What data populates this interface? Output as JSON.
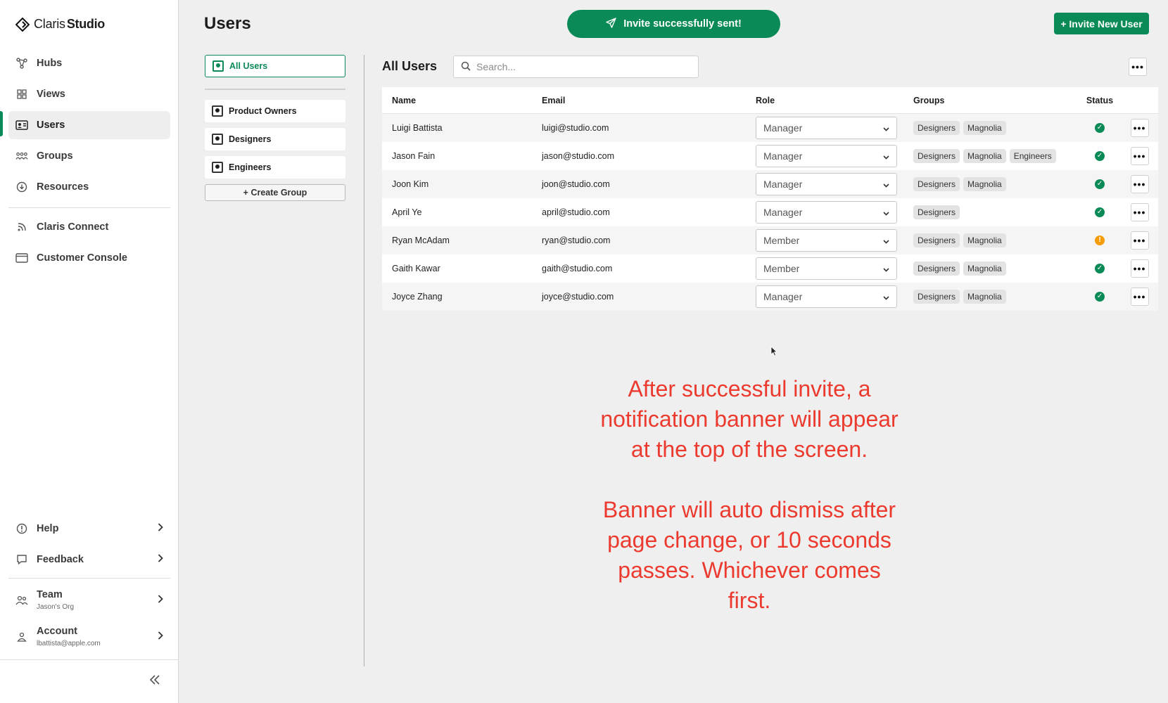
{
  "app": {
    "brand_light": "Claris",
    "brand_bold": "Studio"
  },
  "sidebar": {
    "items": [
      {
        "label": "Hubs",
        "icon": "hubs-icon"
      },
      {
        "label": "Views",
        "icon": "grid-icon"
      },
      {
        "label": "Users",
        "icon": "id-card-icon",
        "active": true
      },
      {
        "label": "Groups",
        "icon": "people-icon"
      },
      {
        "label": "Resources",
        "icon": "download-circle-icon"
      }
    ],
    "secondary": [
      {
        "label": "Claris Connect",
        "icon": "feed-icon"
      },
      {
        "label": "Customer Console",
        "icon": "window-icon"
      }
    ],
    "bottom": [
      {
        "label": "Help",
        "icon": "info-icon"
      },
      {
        "label": "Feedback",
        "icon": "chat-icon"
      }
    ],
    "team": {
      "label": "Team",
      "sub": "Jason's Org"
    },
    "account": {
      "label": "Account",
      "sub": "lbattista@apple.com"
    }
  },
  "header": {
    "title": "Users",
    "toast": "Invite successfully sent!",
    "invite_button": "+ Invite New User"
  },
  "groups": {
    "all": "All Users",
    "list": [
      "Product Owners",
      "Designers",
      "Engineers"
    ],
    "create": "+ Create Group"
  },
  "table": {
    "title": "All Users",
    "search_placeholder": "Search...",
    "columns": [
      "Name",
      "Email",
      "Role",
      "Groups",
      "Status"
    ],
    "rows": [
      {
        "name": "Luigi Battista",
        "email": "luigi@studio.com",
        "role": "Manager",
        "groups": [
          "Designers",
          "Magnolia"
        ],
        "status": "ok"
      },
      {
        "name": "Jason Fain",
        "email": "jason@studio.com",
        "role": "Manager",
        "groups": [
          "Designers",
          "Magnolia",
          "Engineers"
        ],
        "status": "ok"
      },
      {
        "name": "Joon Kim",
        "email": "joon@studio.com",
        "role": "Manager",
        "groups": [
          "Designers",
          "Magnolia"
        ],
        "status": "ok"
      },
      {
        "name": "April Ye",
        "email": "april@studio.com",
        "role": "Manager",
        "groups": [
          "Designers"
        ],
        "status": "ok"
      },
      {
        "name": "Ryan McAdam",
        "email": "ryan@studio.com",
        "role": "Member",
        "groups": [
          "Designers",
          "Magnolia"
        ],
        "status": "warn"
      },
      {
        "name": "Gaith Kawar",
        "email": "gaith@studio.com",
        "role": "Member",
        "groups": [
          "Designers",
          "Magnolia"
        ],
        "status": "ok"
      },
      {
        "name": "Joyce Zhang",
        "email": "joyce@studio.com",
        "role": "Manager",
        "groups": [
          "Designers",
          "Magnolia"
        ],
        "status": "ok"
      }
    ]
  },
  "annotation": {
    "lines": [
      "After successful invite, a",
      "notification banner will appear",
      "at the top of the screen.",
      "",
      "Banner will auto dismiss after",
      "page change, or 10 seconds",
      "passes. Whichever comes",
      "first."
    ]
  },
  "colors": {
    "accent": "#0a8a56",
    "warning": "#f59c0b",
    "annotation": "#ec3a2f"
  }
}
